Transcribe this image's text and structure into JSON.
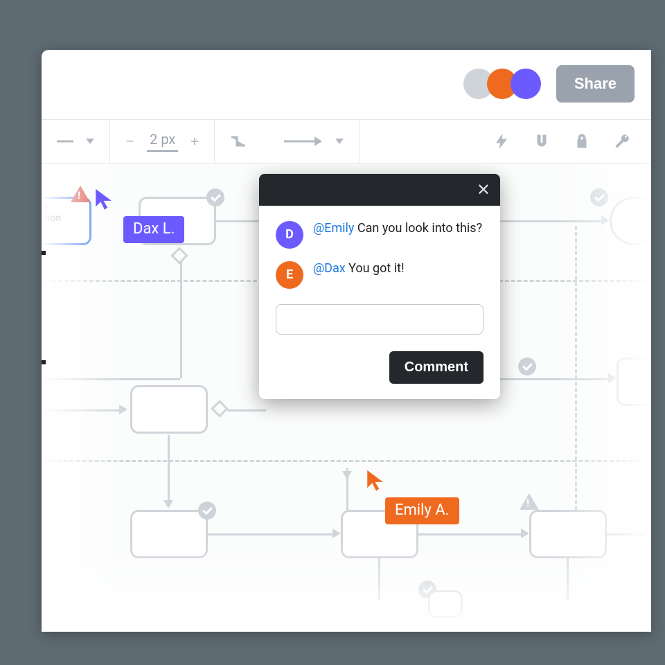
{
  "header": {
    "share_label": "Share"
  },
  "avatars": {
    "colors": [
      "#cfd4db",
      "#ef6a1f",
      "#6b5bff"
    ]
  },
  "toolbar": {
    "stroke_value": "2 px",
    "minus": "–",
    "plus": "+"
  },
  "canvas": {
    "selected_node_label": "roduct\nfiguration"
  },
  "cursors": {
    "dax": {
      "label": "Dax L.",
      "color": "#6b5bff"
    },
    "emily": {
      "label": "Emily A.",
      "color": "#ef6a1f"
    }
  },
  "comments": {
    "thread": [
      {
        "initial": "D",
        "avatar_color": "#6b5bff",
        "mention": "@Emily",
        "text": " Can you look into this?"
      },
      {
        "initial": "E",
        "avatar_color": "#ef6a1f",
        "mention": "@Dax",
        "text": " You got it!"
      }
    ],
    "input_placeholder": "",
    "submit_label": "Comment"
  }
}
